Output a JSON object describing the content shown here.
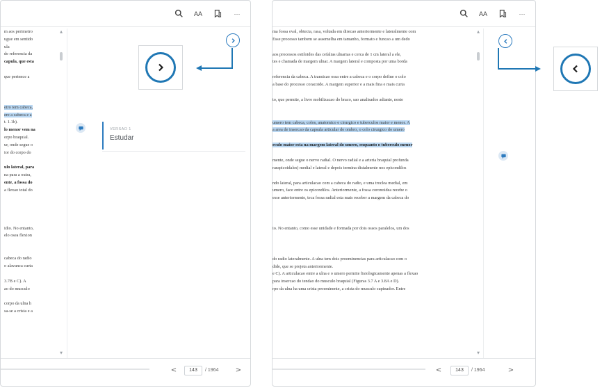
{
  "toolbar": {
    "search_icon": "search-icon",
    "font_label": "AA",
    "bookmark_icon": "bookmark-icon",
    "more_label": "···"
  },
  "left_panel": {
    "text_lines": [
      {
        "t": "m aos perimetro",
        "hl": false,
        "b": false
      },
      {
        "t": "ugue em sentido",
        "hl": false,
        "b": false
      },
      {
        "t": "ula",
        "hl": false,
        "b": false
      },
      {
        "t": "de referencia da",
        "hl": false,
        "b": false
      },
      {
        "t": "capula, que esta",
        "hl": false,
        "b": true
      },
      {
        "gap": true
      },
      {
        "t": "que pertence a",
        "hl": false,
        "b": false
      },
      {
        "gap": true
      },
      {
        "gap": true
      },
      {
        "gap": true
      },
      {
        "t": "etro tem cabeca,",
        "hl": true,
        "b": false
      },
      {
        "t": "ere a cabeca e a",
        "hl": true,
        "b": false
      },
      {
        "t": "t. 1.1b).",
        "hl": false,
        "b": false
      },
      {
        "t": "lo menor vem na",
        "hl": false,
        "b": true
      },
      {
        "t": "orpo braquial.",
        "hl": false,
        "b": false
      },
      {
        "t": "ur, onde segue o",
        "hl": false,
        "b": false
      },
      {
        "t": "ior do corpo do",
        "hl": false,
        "b": false
      },
      {
        "gap": true
      },
      {
        "t": "ulo lateral, para",
        "hl": false,
        "b": true
      },
      {
        "t": "na para a outra,",
        "hl": false,
        "b": false
      },
      {
        "t": "ente, a fossa do",
        "hl": false,
        "b": true
      },
      {
        "t": "a flexao total do",
        "hl": false,
        "b": false
      },
      {
        "gap": true
      },
      {
        "gap": true
      },
      {
        "gap": true
      },
      {
        "gap": true
      },
      {
        "t": "idio. No entanto,",
        "hl": false,
        "b": false
      },
      {
        "t": "elo osea flexion",
        "hl": false,
        "b": false
      },
      {
        "gap": true
      },
      {
        "gap": true
      },
      {
        "t": "cabeca do radio",
        "hl": false,
        "b": false
      },
      {
        "t": "o alavanca curta",
        "hl": false,
        "b": false
      },
      {
        "gap": true
      },
      {
        "t": "3.7B e C). A",
        "hl": false,
        "b": false
      },
      {
        "t": "ao do musculo",
        "hl": false,
        "b": false
      },
      {
        "gap": true
      },
      {
        "t": "corpo da ulna h",
        "hl": false,
        "b": false
      },
      {
        "t": "sa-se a crista e a",
        "hl": false,
        "b": false
      }
    ],
    "note_caption": "VERSAO 1",
    "note_text": "Estudar",
    "page_current": "143",
    "page_total": "/ 1964",
    "prev_label": "<",
    "next_label": ">"
  },
  "right_panel": {
    "text_lines": [
      {
        "t": "ma fossa oval, obtecta, rasa, voltada em direcao anteriormente e lateralmente com",
        "hl": false,
        "b": false
      },
      {
        "t": "Esse processo tambem se assemelha em tamanho, formato e funcao a um dedo",
        "hl": false,
        "b": false
      },
      {
        "gap": true
      },
      {
        "t": "aos processos estiloides das cefalias ulnarias e cerca de 1 cm lateral a ele,",
        "hl": false,
        "b": false
      },
      {
        "t": "tes e chamada de margem ulnar. A margem lateral e composta por uma borda",
        "hl": false,
        "b": false
      },
      {
        "gap": true
      },
      {
        "t": "referencia da cabeca. A transicao ossa entre a cabeca e o corpo define o colo",
        "hl": false,
        "b": false
      },
      {
        "t": "a base do processo coracoide. A margem superior e a mais fina e mais curta",
        "hl": false,
        "b": false
      },
      {
        "gap": true
      },
      {
        "t": "to, que permite, a livre mobilizacao do braco, sao analisados adiante, neste",
        "hl": false,
        "b": false
      },
      {
        "gap": true
      },
      {
        "gap": true
      },
      {
        "t": "umero tem cabeca, colos, anatomico e cirurgico e tuberculos maior e menor. A",
        "hl": true,
        "b": false
      },
      {
        "t": "a area de insercao da capsula articular do ombro, o colo cirurgico do umero",
        "hl": true,
        "b": false
      },
      {
        "gap": true
      },
      {
        "t": "rculo maior esta na margem lateral do umero, enquanto o tuberculo menor",
        "hl": true,
        "b": true
      },
      {
        "gap": true
      },
      {
        "t": "mente, onde segue o nervo radial. O nervo radial e a arteria braquial profunda",
        "hl": false,
        "b": false
      },
      {
        "t": "rarapicoidales) medial e lateral e depois termina distalmente nos epicondilos",
        "hl": false,
        "b": false
      },
      {
        "gap": true
      },
      {
        "t": "ndo lateral, para articulacao com a cabeca do radio, e uma troclea medial, em",
        "hl": false,
        "b": false
      },
      {
        "t": "umero, face entre os epicondilos. Anteriormente, a fossa coronoidea recebe o",
        "hl": false,
        "b": false
      },
      {
        "t": "esse anteriormente, teca fossa radial esta mais receber a margem da cabeca do",
        "hl": false,
        "b": false
      },
      {
        "gap": true
      },
      {
        "gap": true
      },
      {
        "gap": true
      },
      {
        "t": "io. No entanto, como esse unidade e formada por dois ossos paralelos, um dos",
        "hl": false,
        "b": false
      },
      {
        "gap": true
      },
      {
        "gap": true
      },
      {
        "gap": true
      },
      {
        "t": "do radio lateralmente. A ulna tem dois proeminencias para articulacao com o",
        "hl": false,
        "b": false
      },
      {
        "t": "dide, que se projeta anteriormente.",
        "hl": false,
        "b": false
      },
      {
        "t": "e C). A articulacao entre a ulna e o umero permite fisiologicamente apenas a flexao",
        "hl": false,
        "b": false
      },
      {
        "t": "para insercao do tendao do musculo braquial (Figuras 3.7 A e 3.8A e D).",
        "hl": false,
        "b": false
      },
      {
        "t": "rpo da ulna ha uma crista proeminente, a crista do musculo supinador. Entre",
        "hl": false,
        "b": false
      }
    ],
    "page_current": "143",
    "page_total": "/ 1964",
    "prev_label": "<",
    "next_label": ">"
  },
  "colors": {
    "accent": "#2c7bbf",
    "callout": "#1f77b4",
    "highlight": "#b9d7f2"
  }
}
